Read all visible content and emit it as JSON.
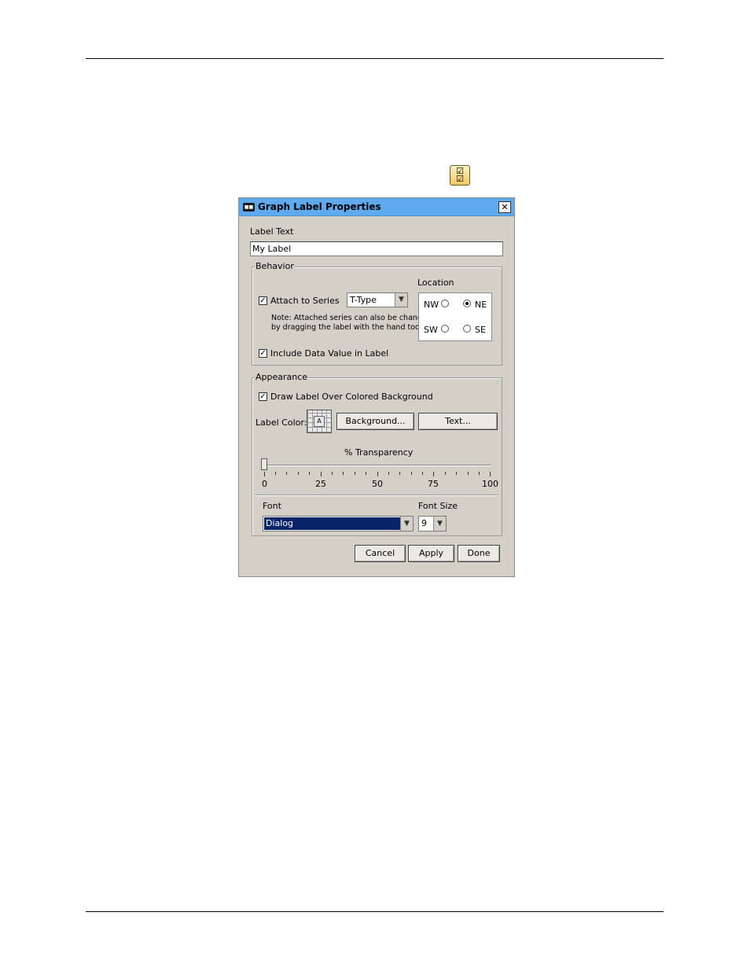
{
  "toolbar_icon": {
    "name": "properties-checklist-icon",
    "glyph": "☑"
  },
  "dialog": {
    "title": "Graph Label Properties",
    "close_glyph": "✕",
    "label_text": {
      "heading": "Label Text",
      "value": "My Label"
    },
    "behavior": {
      "title": "Behavior",
      "attach_to_series": {
        "label": "Attach to Series",
        "checked": true
      },
      "series_combo": {
        "value": "T-Type"
      },
      "note_line1": "Note: Attached series can also be changed",
      "note_line2": "by dragging the label with the hand tool",
      "include_data_value": {
        "label": "Include Data Value in Label",
        "checked": true
      },
      "location": {
        "heading": "Location",
        "nw": "NW",
        "ne": "NE",
        "sw": "SW",
        "se": "SE",
        "selected": "NE"
      }
    },
    "appearance": {
      "title": "Appearance",
      "draw_over_background": {
        "label": "Draw Label Over Colored Background",
        "checked": true
      },
      "label_color": "Label Color:",
      "swatch_letter": "A",
      "background_button": "Background...",
      "text_button": "Text...",
      "transparency": {
        "heading": "% Transparency",
        "value": 0,
        "ticks": [
          "0",
          "25",
          "50",
          "75",
          "100"
        ]
      },
      "font": {
        "heading": "Font",
        "value": "Dialog"
      },
      "font_size": {
        "heading": "Font Size",
        "value": "9"
      }
    },
    "buttons": {
      "cancel": "Cancel",
      "apply": "Apply",
      "done": "Done"
    },
    "colors": {
      "titlebar": "#5fa9ef",
      "panel": "#d4d0c8",
      "selection": "#0a246a"
    }
  }
}
